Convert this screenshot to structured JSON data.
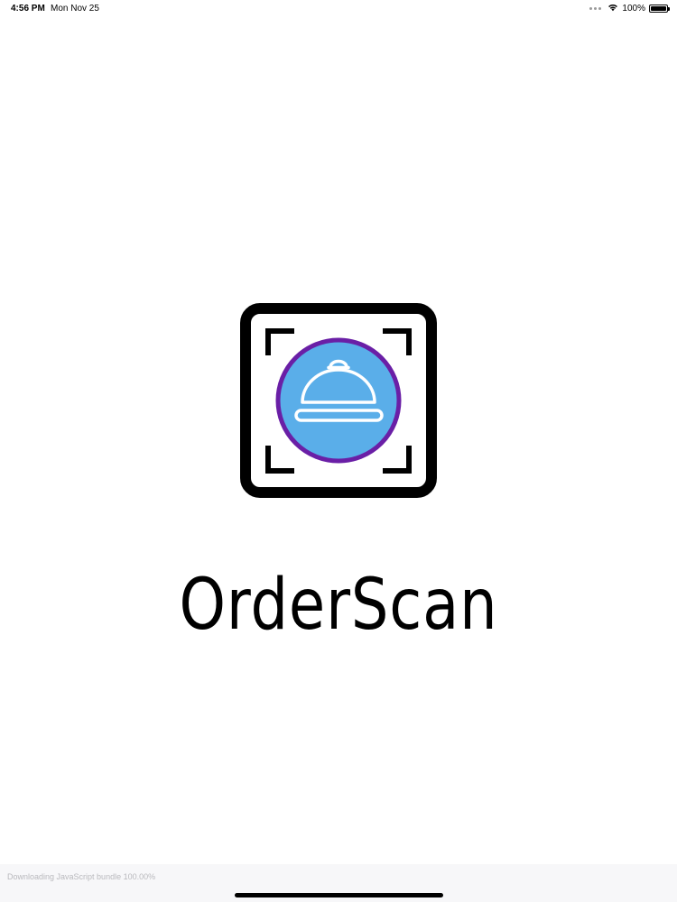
{
  "status_bar": {
    "time": "4:56 PM",
    "date": "Mon Nov 25",
    "battery_percent": "100%",
    "battery_level": 1.0,
    "icons": [
      "wifi-icon",
      "battery-icon"
    ]
  },
  "app": {
    "name": "OrderScan",
    "logo_icon": "cloche-scan-icon"
  },
  "colors": {
    "frame": "#000000",
    "circle_fill": "#5aaee9",
    "circle_ring": "#6a1fa6",
    "cloche": "#ffffff"
  },
  "bundle_status": {
    "text": "Downloading JavaScript bundle 100.00%"
  }
}
